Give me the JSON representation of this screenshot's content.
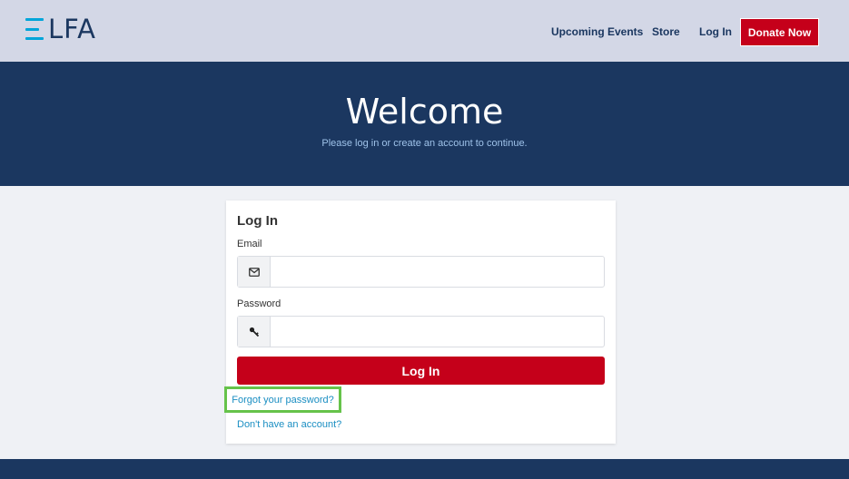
{
  "header": {
    "logo_text": "LFA",
    "nav": {
      "upcoming_events": "Upcoming Events",
      "store": "Store",
      "login": "Log In"
    },
    "donate_label": "Donate Now"
  },
  "hero": {
    "title": "Welcome",
    "subtitle": "Please log in or create an account to continue."
  },
  "login_form": {
    "title": "Log In",
    "email_label": "Email",
    "email_value": "",
    "email_icon": "envelope-icon",
    "password_label": "Password",
    "password_value": "",
    "password_icon": "key-icon",
    "submit_label": "Log In",
    "forgot_link": "Forgot your password?",
    "signup_link": "Don't have an account?"
  },
  "colors": {
    "header_bg": "#d3d7e6",
    "navy": "#1b3760",
    "brand_red": "#c5001a",
    "link": "#1a8ec2",
    "highlight": "#66c34a",
    "logo_accent": "#00a5d9"
  }
}
